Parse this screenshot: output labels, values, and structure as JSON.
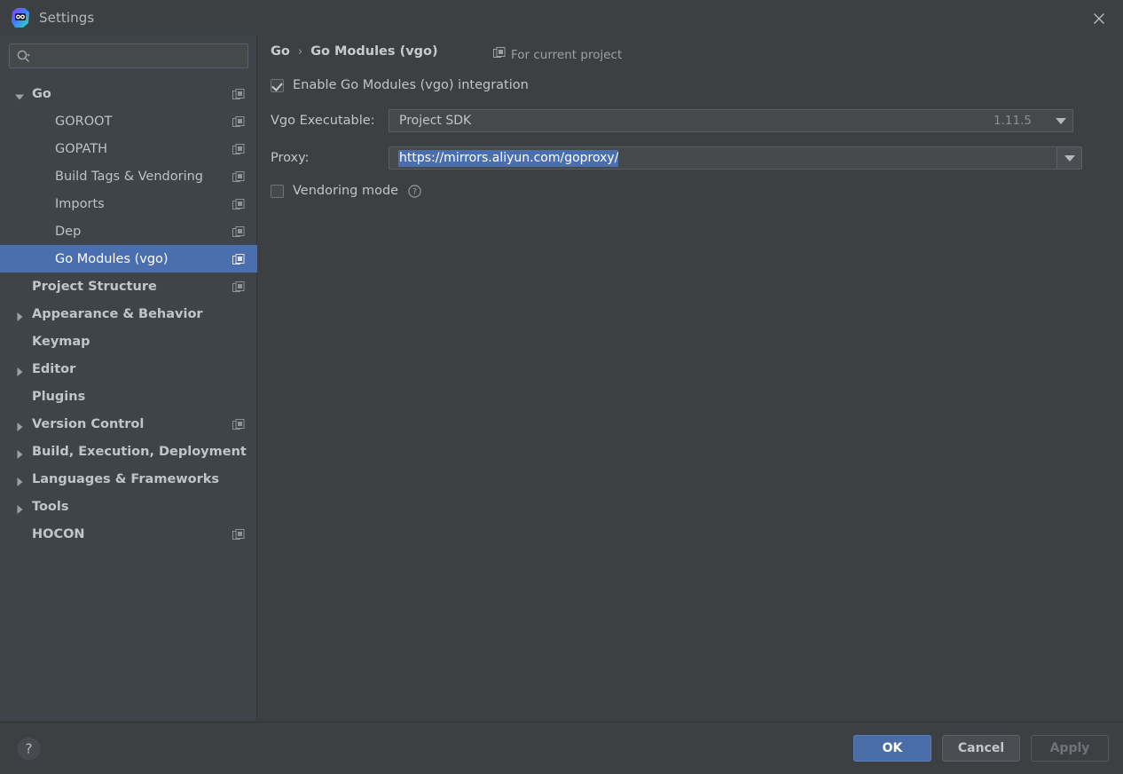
{
  "window": {
    "title": "Settings",
    "app_icon": "goland-logo-icon",
    "close_icon": "close-icon"
  },
  "sidebar": {
    "search": {
      "placeholder": "",
      "value": "",
      "icon": "search-icon"
    },
    "items": [
      {
        "label": "Go",
        "level": 0,
        "expanded": true,
        "arrow": "chevron-down-icon",
        "scope_icon": true,
        "selected": false
      },
      {
        "label": "GOROOT",
        "level": 1,
        "expanded": null,
        "arrow": "",
        "scope_icon": true,
        "selected": false
      },
      {
        "label": "GOPATH",
        "level": 1,
        "expanded": null,
        "arrow": "",
        "scope_icon": true,
        "selected": false
      },
      {
        "label": "Build Tags & Vendoring",
        "level": 1,
        "expanded": null,
        "arrow": "",
        "scope_icon": true,
        "selected": false
      },
      {
        "label": "Imports",
        "level": 1,
        "expanded": null,
        "arrow": "",
        "scope_icon": true,
        "selected": false
      },
      {
        "label": "Dep",
        "level": 1,
        "expanded": null,
        "arrow": "",
        "scope_icon": true,
        "selected": false
      },
      {
        "label": "Go Modules (vgo)",
        "level": 1,
        "expanded": null,
        "arrow": "",
        "scope_icon": true,
        "selected": true
      },
      {
        "label": "Project Structure",
        "level": 0,
        "expanded": null,
        "arrow": "",
        "scope_icon": true,
        "selected": false
      },
      {
        "label": "Appearance & Behavior",
        "level": 0,
        "expanded": false,
        "arrow": "chevron-right-icon",
        "scope_icon": false,
        "selected": false
      },
      {
        "label": "Keymap",
        "level": 0,
        "expanded": null,
        "arrow": "",
        "scope_icon": false,
        "selected": false
      },
      {
        "label": "Editor",
        "level": 0,
        "expanded": false,
        "arrow": "chevron-right-icon",
        "scope_icon": false,
        "selected": false
      },
      {
        "label": "Plugins",
        "level": 0,
        "expanded": null,
        "arrow": "",
        "scope_icon": false,
        "selected": false
      },
      {
        "label": "Version Control",
        "level": 0,
        "expanded": false,
        "arrow": "chevron-right-icon",
        "scope_icon": true,
        "selected": false
      },
      {
        "label": "Build, Execution, Deployment",
        "level": 0,
        "expanded": false,
        "arrow": "chevron-right-icon",
        "scope_icon": false,
        "selected": false
      },
      {
        "label": "Languages & Frameworks",
        "level": 0,
        "expanded": false,
        "arrow": "chevron-right-icon",
        "scope_icon": false,
        "selected": false
      },
      {
        "label": "Tools",
        "level": 0,
        "expanded": false,
        "arrow": "chevron-right-icon",
        "scope_icon": false,
        "selected": false
      },
      {
        "label": "HOCON",
        "level": 0,
        "expanded": null,
        "arrow": "",
        "scope_icon": true,
        "selected": false
      }
    ]
  },
  "main": {
    "breadcrumb": {
      "root": "Go",
      "separator": "›",
      "current": "Go Modules (vgo)"
    },
    "scope_note": {
      "text": "For current project",
      "icon": "project-scope-icon"
    },
    "enable_checkbox": {
      "label": "Enable Go Modules (vgo) integration",
      "checked": true
    },
    "vgo_executable": {
      "label": "Vgo Executable:",
      "value": "Project SDK",
      "version": "1.11.5",
      "dropdown_icon": "chevron-down-icon",
      "browse_label": "..."
    },
    "proxy": {
      "label": "Proxy:",
      "value": "https://mirrors.aliyun.com/goproxy/",
      "selected": true,
      "dropdown_icon": "chevron-down-icon",
      "help_icon": "help-circle-icon"
    },
    "vendoring": {
      "label": "Vendoring mode",
      "checked": false,
      "help_icon": "help-circle-icon"
    }
  },
  "footer": {
    "help_icon": "help-circle-icon",
    "ok": "OK",
    "cancel": "Cancel",
    "apply": "Apply",
    "apply_disabled": true
  },
  "colors": {
    "window_bg": "#3c4043",
    "sidebar_bg": "#3f434a",
    "selection_blue": "#4b6eaf",
    "primary_button": "#4a6da7",
    "text": "#bbbbbb"
  }
}
